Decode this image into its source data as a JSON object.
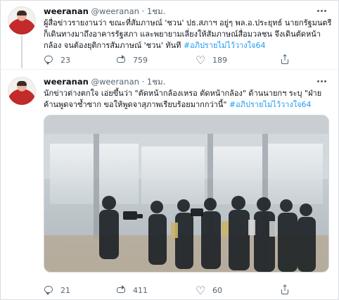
{
  "colors": {
    "link": "#1d9bf0",
    "text": "#0f1419",
    "muted": "#536471",
    "border": "#cfd9de"
  },
  "tweets": [
    {
      "user": {
        "name": "weeranan",
        "handle": "@weeranan",
        "time": "1ชม."
      },
      "text_main": "ผู้สื่อข่าวรายงานว่า ขณะที่สัมภาษณ์ 'ชวน' ปธ.สภาฯ อยู่ๆ พล.อ.ประยุทธ์ นายกรัฐมนตรี ก็เดินทางมาถึงอาคารรัฐสภา และพยายามเลี่ยงให้สัมภาษณ์สื่อมวลชน จึงเดินตัดหน้ากล้อง จนต้องยุติการสัมภาษณ์ 'ชวน' ทันที",
      "hashtag": "#อภิปรายไม่ไว้วางใจ64",
      "stats": {
        "replies": "23",
        "retweets": "759",
        "likes": "189"
      }
    },
    {
      "user": {
        "name": "weeranan",
        "handle": "@weeranan",
        "time": "1ชม."
      },
      "text_main": "นักข่าวต่างตกใจ เอ่ยขึ้นว่า \"ตัดหน้ากล้องเหรอ ตัดหน้ากล้อง\" ด้านนายกฯ ระบุ \"ฝ่ายค้านพูดจาซ้ำซาก ขอให้พูดจาสุภาพเรียบร้อยมากกว่านี้\"",
      "hashtag": "#อภิปรายไม่ไว้วางใจ64",
      "stats": {
        "replies": "21",
        "retweets": "411",
        "likes": "60"
      }
    }
  ],
  "icons": {
    "more": "more-icon",
    "reply": "reply-icon",
    "retweet": "retweet-icon",
    "like": "like-icon",
    "share": "share-icon"
  }
}
